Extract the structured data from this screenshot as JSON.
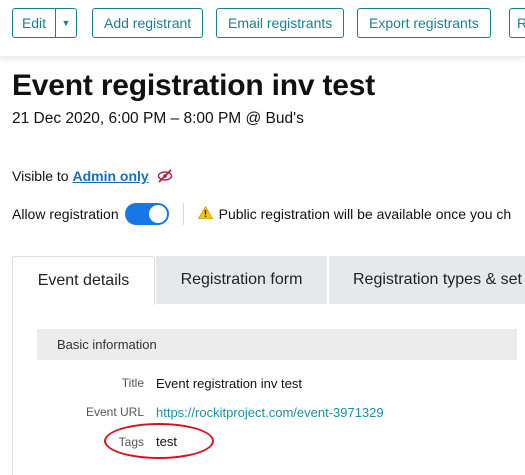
{
  "toolbar": {
    "edit": "Edit",
    "add_registrant": "Add registrant",
    "email_registrants": "Email registrants",
    "export_registrants": "Export registrants",
    "next_partial": "R"
  },
  "event": {
    "title": "Event registration inv test",
    "when": "21 Dec 2020, 6:00 PM – 8:00 PM @ Bud's"
  },
  "visibility": {
    "prefix": "Visible to",
    "value": "Admin only"
  },
  "registration": {
    "label": "Allow registration",
    "enabled": true,
    "notice": "Public registration will be available once you ch"
  },
  "tabs": [
    {
      "label": "Event details",
      "active": true
    },
    {
      "label": "Registration form",
      "active": false
    },
    {
      "label": "Registration types & set",
      "active": false
    }
  ],
  "section": {
    "title": "Basic information"
  },
  "fields": {
    "title": {
      "label": "Title",
      "value": "Event registration inv test"
    },
    "url": {
      "label": "Event URL",
      "value": "https://rockitproject.com/event-3971329"
    },
    "tags": {
      "label": "Tags",
      "value": "test"
    }
  },
  "colors": {
    "accent": "#1b7f8f",
    "link": "#1a6fb4",
    "toggle": "#1677e6",
    "annotation": "#d8121c"
  }
}
